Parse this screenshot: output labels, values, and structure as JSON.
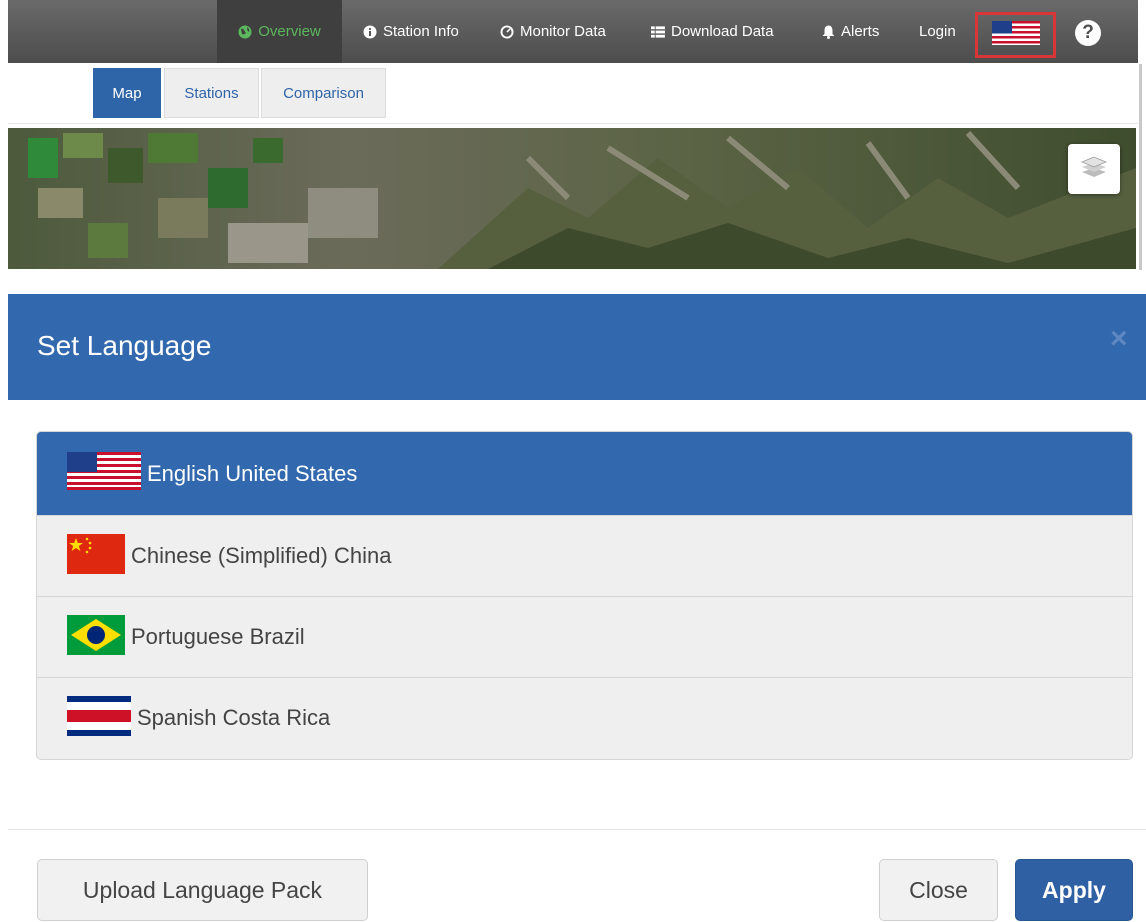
{
  "navbar": {
    "items": [
      {
        "label": "Overview",
        "icon": "globe-icon",
        "active": true
      },
      {
        "label": "Station Info",
        "icon": "info-icon"
      },
      {
        "label": "Monitor Data",
        "icon": "dashboard-icon"
      },
      {
        "label": "Download Data",
        "icon": "list-icon"
      },
      {
        "label": "Alerts",
        "icon": "bell-icon"
      },
      {
        "label": "Login"
      }
    ],
    "language_flag": "us-flag-icon",
    "help_label": "?",
    "active_color": "#5cb85c"
  },
  "tabs": [
    {
      "label": "Map",
      "active": true
    },
    {
      "label": "Stations"
    },
    {
      "label": "Comparison"
    }
  ],
  "map": {
    "layers_icon": "layers-icon"
  },
  "modal": {
    "title": "Set Language",
    "close_label": "×",
    "languages": [
      {
        "label": "English United States",
        "flag": "us-flag-icon",
        "selected": true
      },
      {
        "label": "Chinese (Simplified) China",
        "flag": "china-flag-icon"
      },
      {
        "label": "Portuguese Brazil",
        "flag": "brazil-flag-icon"
      },
      {
        "label": "Spanish Costa Rica",
        "flag": "costa-rica-flag-icon"
      }
    ],
    "upload_label": "Upload Language Pack",
    "close_button_label": "Close",
    "apply_label": "Apply"
  },
  "colors": {
    "primary": "#3268ad",
    "highlight": "#d9363a",
    "navbar": "#555555"
  }
}
